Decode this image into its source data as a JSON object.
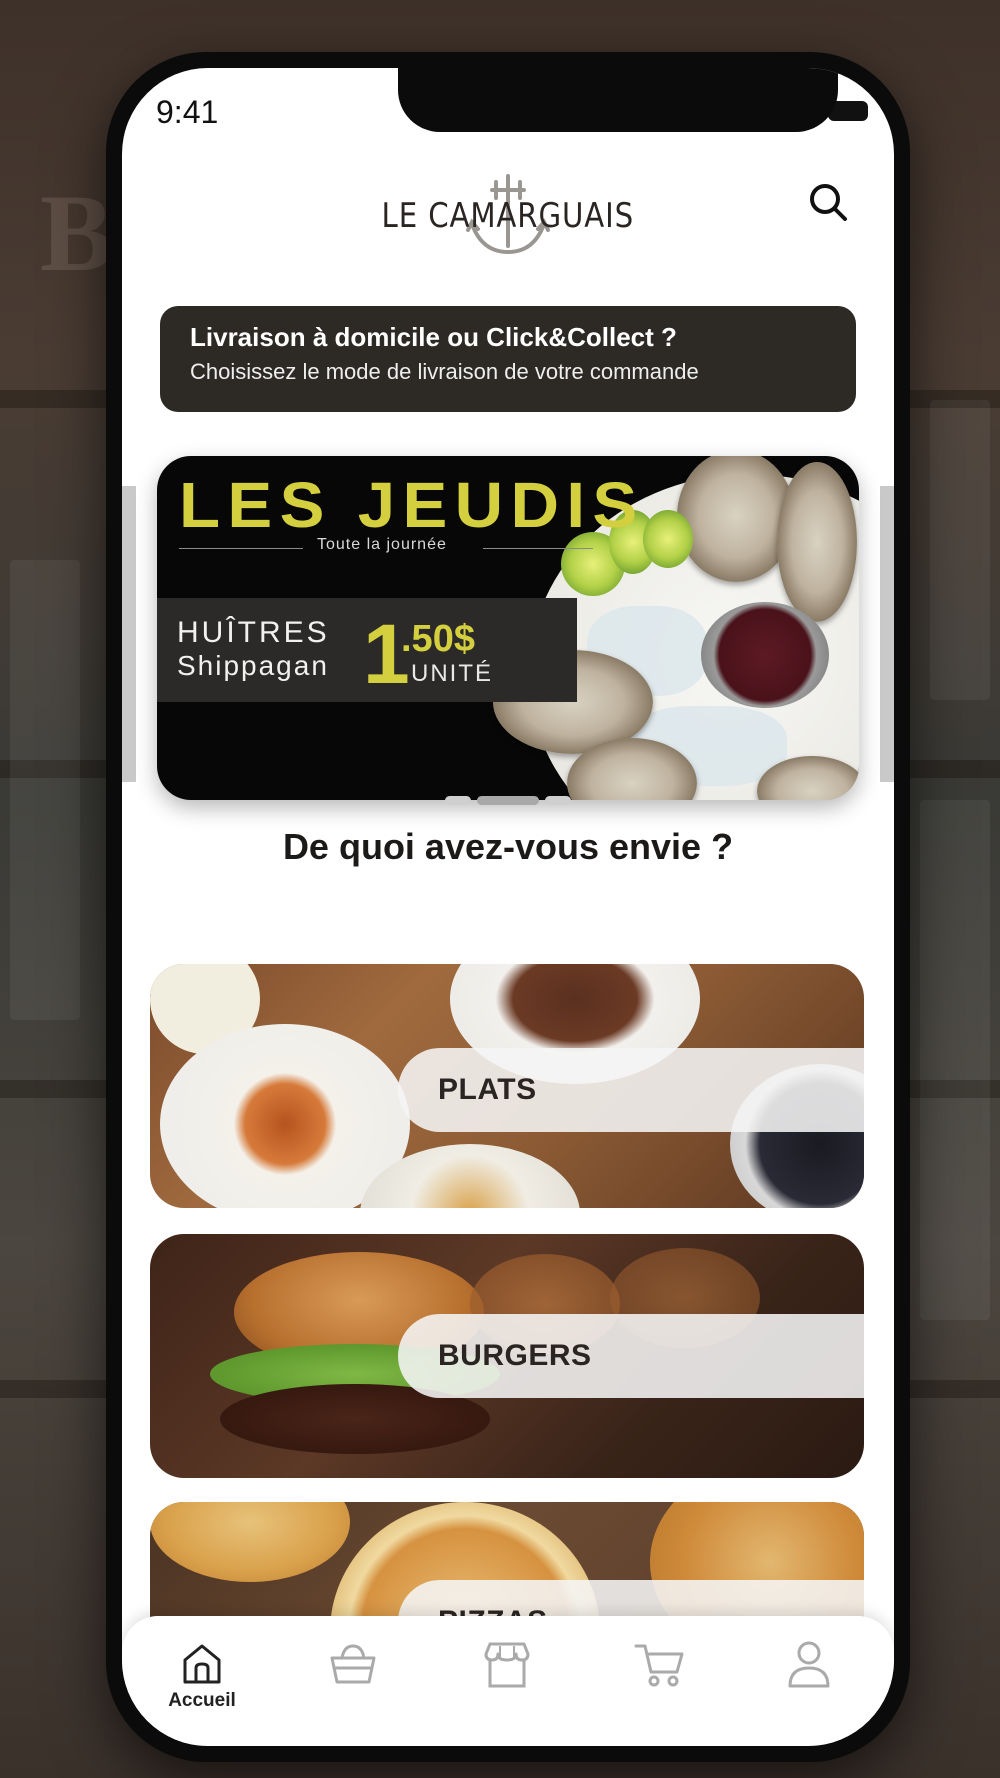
{
  "status": {
    "time": "9:41"
  },
  "header": {
    "brand": "LE CAMARGUAIS"
  },
  "delivery": {
    "title": "Livraison à domicile ou Click&Collect ?",
    "subtitle": "Choisissez le mode de livraison de votre commande"
  },
  "promo": {
    "title": "LES JEUDIS",
    "subtitle": "Toute la journée",
    "product_line1": "HUÎTRES",
    "product_line2": "Shippagan",
    "price_int": "1",
    "price_dec": ".50$",
    "unit": "UNITÉ",
    "slide_count": 3,
    "active_slide": 2
  },
  "section_title": "De quoi avez-vous envie ?",
  "categories": [
    {
      "label": "PLATS"
    },
    {
      "label": "BURGERS"
    },
    {
      "label": "PIZZAS"
    }
  ],
  "tabbar": {
    "items": [
      {
        "label": "Accueil",
        "icon": "home-icon",
        "active": true
      },
      {
        "label": "",
        "icon": "basket-icon",
        "active": false
      },
      {
        "label": "",
        "icon": "store-icon",
        "active": false
      },
      {
        "label": "",
        "icon": "cart-icon",
        "active": false
      },
      {
        "label": "",
        "icon": "profile-icon",
        "active": false
      }
    ]
  },
  "colors": {
    "accent": "#d4cf3f",
    "banner": "#2d2925"
  }
}
